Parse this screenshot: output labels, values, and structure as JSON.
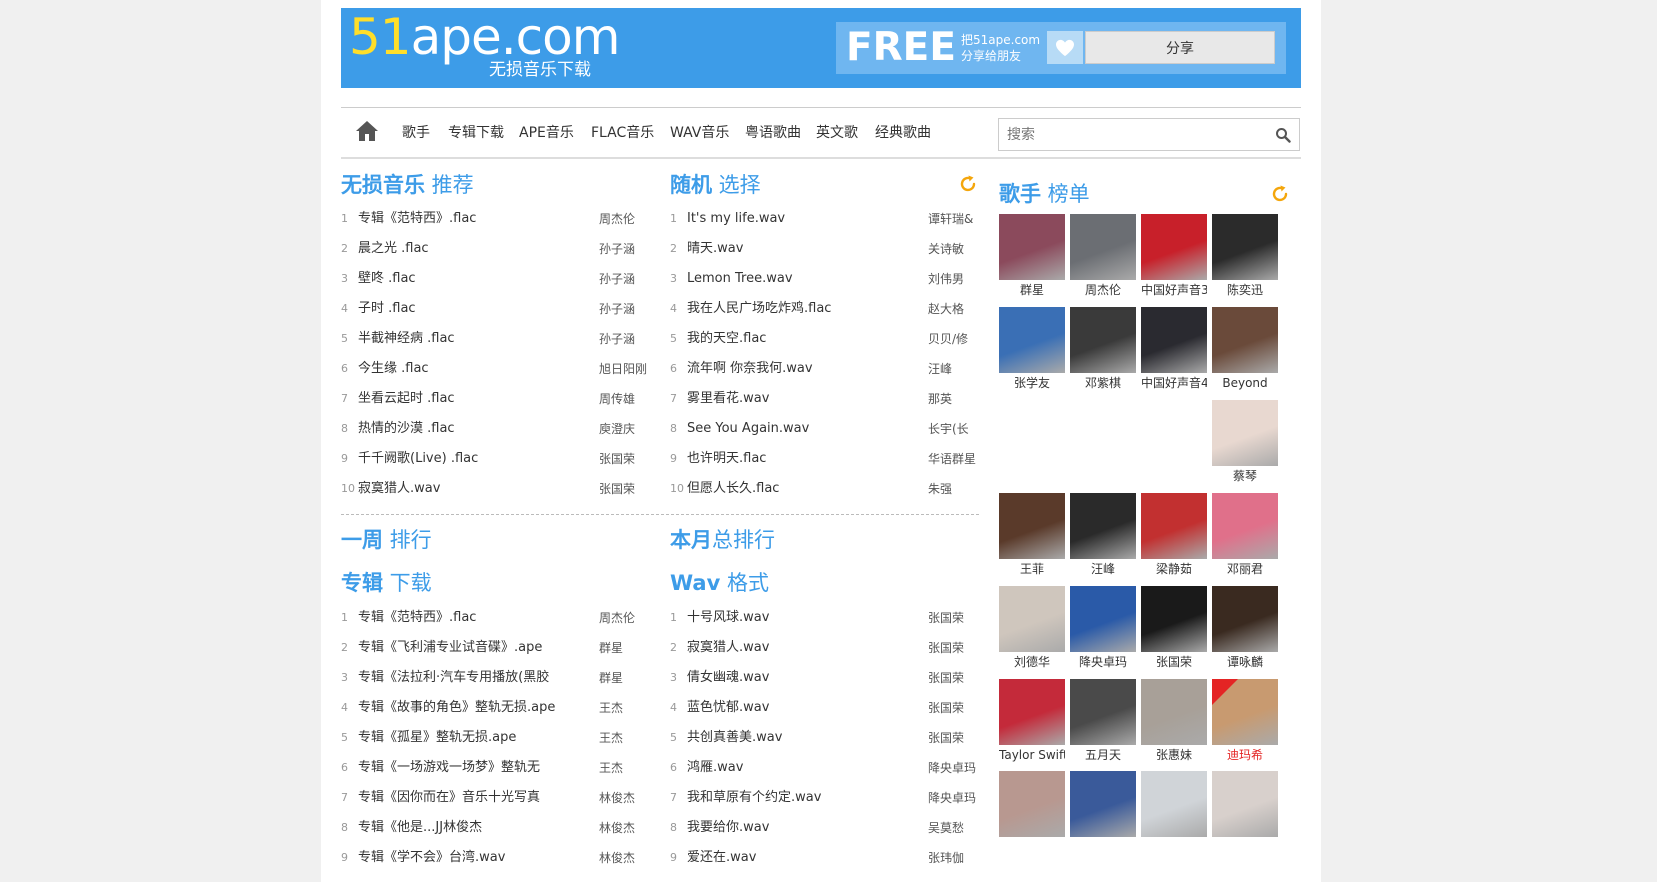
{
  "logo": {
    "part1": "51",
    "part2": "ape.com",
    "tagline": "无损音乐下载"
  },
  "share": {
    "free": "FREE",
    "line1": "把51ape.com",
    "line2": "分享给朋友",
    "button": "分享"
  },
  "nav": {
    "items": [
      "歌手",
      "专辑下载",
      "APE音乐",
      "FLAC音乐",
      "WAV音乐",
      "粤语歌曲",
      "英文歌",
      "经典歌曲"
    ],
    "search_placeholder": "搜索"
  },
  "sections": {
    "recommend": {
      "title_bold": "无损音乐",
      "title_rest": " 推荐"
    },
    "random": {
      "title_bold": "随机",
      "title_rest": " 选择"
    },
    "singers": {
      "title_bold": "歌手",
      "title_rest": " 榜单"
    },
    "week": {
      "title_bold": "一周",
      "title_rest": " 排行"
    },
    "month": {
      "title_bold": "本月",
      "title_rest": "总排行"
    },
    "album": {
      "title_bold": "专辑",
      "title_rest": " 下载"
    },
    "wav": {
      "title_bold": "Wav",
      "title_rest": " 格式"
    }
  },
  "recommend_list": [
    {
      "num": "1",
      "name": "专辑《范特西》.flac",
      "artist": "周杰伦"
    },
    {
      "num": "2",
      "name": "晨之光 .flac",
      "artist": "孙子涵"
    },
    {
      "num": "3",
      "name": "壁咚 .flac",
      "artist": "孙子涵"
    },
    {
      "num": "4",
      "name": "子时 .flac",
      "artist": "孙子涵"
    },
    {
      "num": "5",
      "name": "半截神经病 .flac",
      "artist": "孙子涵"
    },
    {
      "num": "6",
      "name": "今生缘 .flac",
      "artist": "旭日阳刚"
    },
    {
      "num": "7",
      "name": "坐看云起时 .flac",
      "artist": "周传雄"
    },
    {
      "num": "8",
      "name": "热情的沙漠 .flac",
      "artist": "庾澄庆"
    },
    {
      "num": "9",
      "name": "千千阙歌(Live) .flac",
      "artist": "张国荣"
    },
    {
      "num": "10",
      "name": "寂寞猎人.wav",
      "artist": "张国荣"
    }
  ],
  "random_list": [
    {
      "num": "1",
      "name": "It's my life.wav",
      "artist": "谭轩瑞&"
    },
    {
      "num": "2",
      "name": "晴天.wav",
      "artist": "关诗敏"
    },
    {
      "num": "3",
      "name": "Lemon Tree.wav",
      "artist": "刘伟男"
    },
    {
      "num": "4",
      "name": "我在人民广场吃炸鸡.flac",
      "artist": "赵大格"
    },
    {
      "num": "5",
      "name": "我的天空.flac",
      "artist": "贝贝/修"
    },
    {
      "num": "6",
      "name": "流年啊 你奈我何.wav",
      "artist": "汪峰"
    },
    {
      "num": "7",
      "name": "雾里看花.wav",
      "artist": "那英"
    },
    {
      "num": "8",
      "name": "See You Again.wav",
      "artist": "长宇(长"
    },
    {
      "num": "9",
      "name": "也许明天.flac",
      "artist": "华语群星"
    },
    {
      "num": "10",
      "name": "但愿人长久.flac",
      "artist": "朱强"
    }
  ],
  "album_list": [
    {
      "num": "1",
      "name": "专辑《范特西》.flac",
      "artist": "周杰伦"
    },
    {
      "num": "2",
      "name": "专辑《飞利浦专业试音碟》.ape",
      "artist": "群星"
    },
    {
      "num": "3",
      "name": "专辑《法拉利·汽车专用播放(黑胶",
      "artist": "群星"
    },
    {
      "num": "4",
      "name": "专辑《故事的角色》整轨无损.ape",
      "artist": "王杰"
    },
    {
      "num": "5",
      "name": "专辑《孤星》整轨无损.ape",
      "artist": "王杰"
    },
    {
      "num": "6",
      "name": "专辑《一场游戏一场梦》整轨无",
      "artist": "王杰"
    },
    {
      "num": "7",
      "name": "专辑《因你而在》音乐十光写真",
      "artist": "林俊杰"
    },
    {
      "num": "8",
      "name": "专辑《他是...JJ林俊杰",
      "artist": "林俊杰"
    },
    {
      "num": "9",
      "name": "专辑《学不会》台湾.wav",
      "artist": "林俊杰"
    }
  ],
  "wav_list": [
    {
      "num": "1",
      "name": "十号风球.wav",
      "artist": "张国荣"
    },
    {
      "num": "2",
      "name": "寂寞猎人.wav",
      "artist": "张国荣"
    },
    {
      "num": "3",
      "name": "倩女幽魂.wav",
      "artist": "张国荣"
    },
    {
      "num": "4",
      "name": "蓝色忧郁.wav",
      "artist": "张国荣"
    },
    {
      "num": "5",
      "name": "共创真善美.wav",
      "artist": "张国荣"
    },
    {
      "num": "6",
      "name": "鸿雁.wav",
      "artist": "降央卓玛"
    },
    {
      "num": "7",
      "name": "我和草原有个约定.wav",
      "artist": "降央卓玛"
    },
    {
      "num": "8",
      "name": "我要给你.wav",
      "artist": "吴莫愁"
    },
    {
      "num": "9",
      "name": "爱还在.wav",
      "artist": "张玮伽"
    }
  ],
  "singers": [
    {
      "name": "群星",
      "color": "#8b4a5c"
    },
    {
      "name": "周杰伦",
      "color": "#6b6e73"
    },
    {
      "name": "中国好声音3",
      "color": "#c8202a"
    },
    {
      "name": "陈奕迅",
      "color": "#2b2b2b"
    },
    {
      "name": "张学友",
      "color": "#3a6fb5"
    },
    {
      "name": "邓紫棋",
      "color": "#3a3a3a"
    },
    {
      "name": "中国好声音4",
      "color": "#2a2a30"
    },
    {
      "name": "Beyond",
      "color": "#6a4a3a"
    },
    {
      "name": "蔡琴",
      "color": "#e8d8d0"
    },
    {
      "name": "王菲",
      "color": "#5a3a2a"
    },
    {
      "name": "汪峰",
      "color": "#2a2a2a"
    },
    {
      "name": "梁静茹",
      "color": "#c23030"
    },
    {
      "name": "邓丽君",
      "color": "#e0708a"
    },
    {
      "name": "刘德华",
      "color": "#cfc6bd"
    },
    {
      "name": "降央卓玛",
      "color": "#2a5aa8"
    },
    {
      "name": "张国荣",
      "color": "#1a1a1a"
    },
    {
      "name": "谭咏麟",
      "color": "#3a2a20"
    },
    {
      "name": "Taylor Swift",
      "color": "#c42a3a"
    },
    {
      "name": "五月天",
      "color": "#4a4a4a"
    },
    {
      "name": "张惠妹",
      "color": "#a8a098"
    },
    {
      "name": "迪玛希",
      "color": "#c89a70",
      "red": true,
      "new": true
    },
    {
      "name": "",
      "color": "#b89890"
    },
    {
      "name": "",
      "color": "#3a5a9a"
    },
    {
      "name": "",
      "color": "#d0d4d8"
    },
    {
      "name": "",
      "color": "#d8d0cc"
    }
  ],
  "colors": {
    "brand": "#3d9ce8",
    "accent_yellow": "#ffde2a",
    "refresh_orange": "#f4a60c",
    "new_red": "#e42424"
  }
}
